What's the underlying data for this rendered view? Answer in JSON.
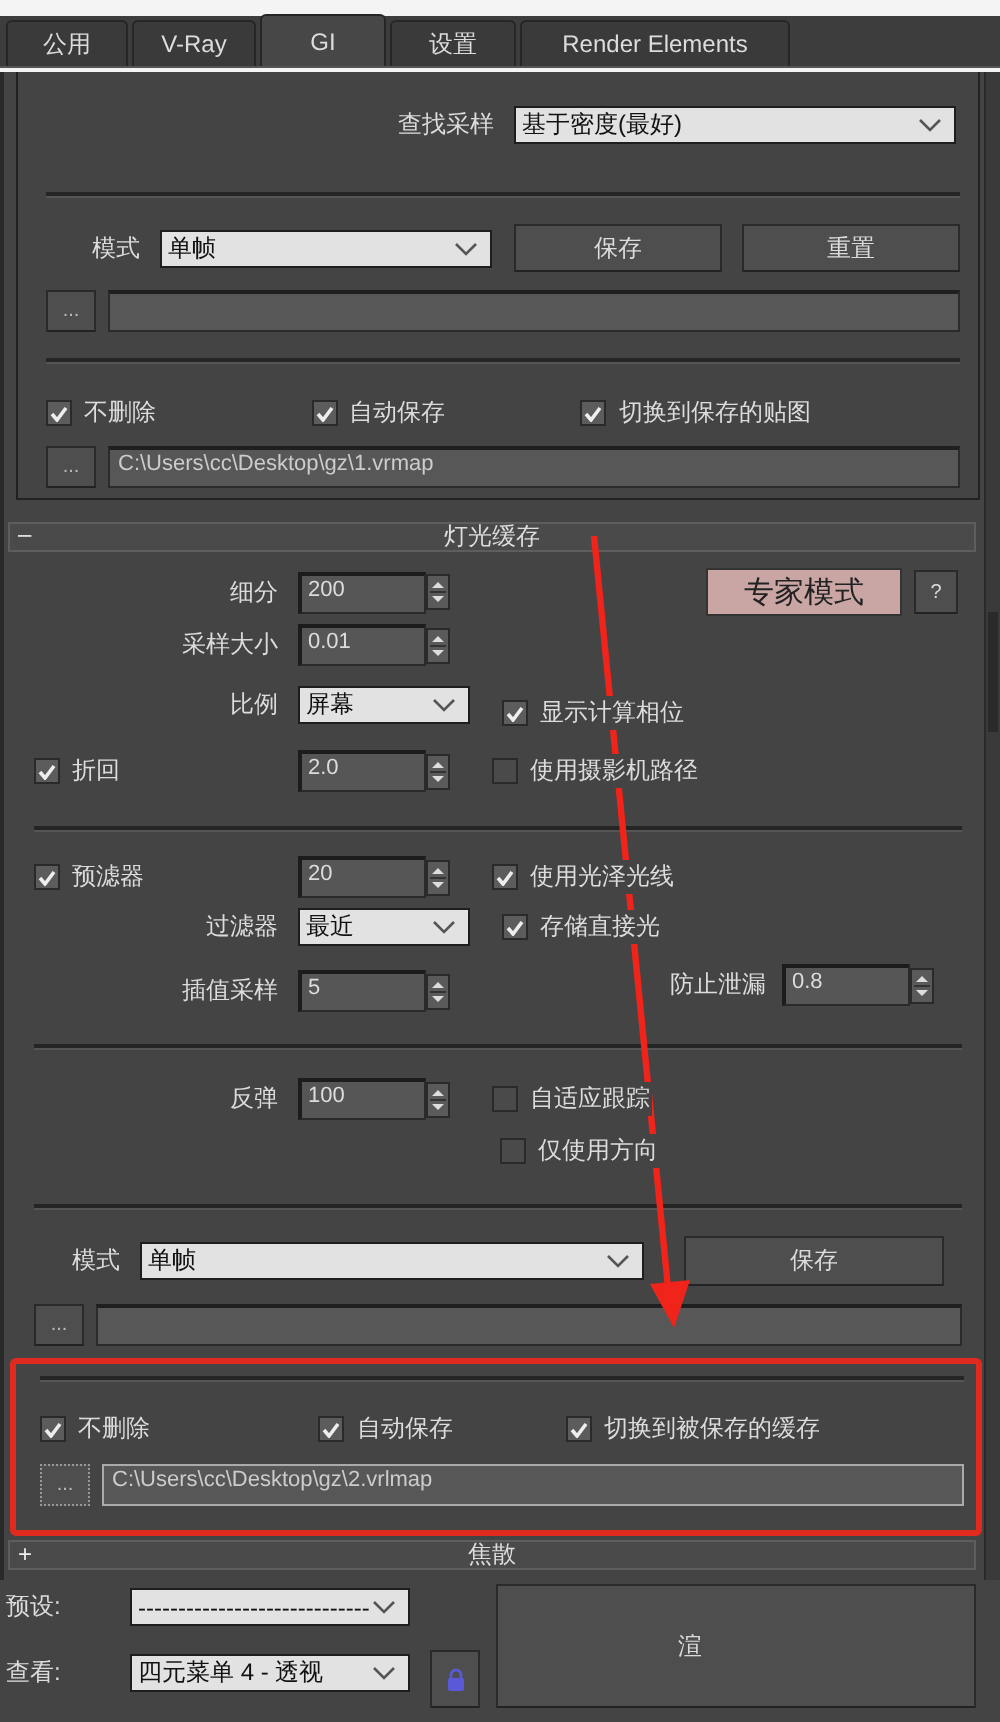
{
  "tabs": [
    {
      "label": "公用",
      "selected": false
    },
    {
      "label": "V-Ray",
      "selected": false
    },
    {
      "label": "GI",
      "selected": true
    },
    {
      "label": "设置",
      "selected": false
    },
    {
      "label": "Render Elements",
      "selected": false
    }
  ],
  "irradiance_map": {
    "lookup": {
      "label": "查找采样",
      "value": "基于密度(最好)"
    },
    "mode": {
      "label": "模式",
      "value": "单帧"
    },
    "buttons": [
      "保存",
      "重置"
    ],
    "file_browse": "...",
    "options": [
      {
        "label": "不删除",
        "checked": true
      },
      {
        "label": "自动保存",
        "checked": true
      },
      {
        "label": "切换到保存的贴图",
        "checked": true
      }
    ],
    "auto_save_browse": "...",
    "auto_save_path": "C:\\Users\\cc\\Desktop\\gz\\1.vrmap"
  },
  "light_cache": {
    "title": "灯光缓存",
    "toggle": "–",
    "expert_mode": "专家模式",
    "help": "?",
    "subdivs": {
      "label": "细分",
      "value": "200"
    },
    "sample_size": {
      "label": "采样大小",
      "value": "0.01"
    },
    "scale": {
      "label": "比例",
      "value": "屏幕"
    },
    "show_calc_phase": {
      "label": "显示计算相位",
      "checked": true
    },
    "retrace": {
      "label": "折回",
      "checked": true,
      "value": "2.0"
    },
    "use_camera_path": {
      "label": "使用摄影机路径",
      "checked": false
    },
    "prefilter": {
      "label": "预滤器",
      "checked": true,
      "value": "20"
    },
    "use_glossy_rays": {
      "label": "使用光泽光线",
      "checked": true
    },
    "filter": {
      "label": "过滤器",
      "value": "最近"
    },
    "store_direct_light": {
      "label": "存储直接光",
      "checked": true
    },
    "interp_samples": {
      "label": "插值采样",
      "value": "5"
    },
    "leak_prevention": {
      "label": "防止泄漏",
      "value": "0.8"
    },
    "bounces": {
      "label": "反弹",
      "value": "100"
    },
    "adaptive_tracing": {
      "label": "自适应跟踪",
      "checked": false
    },
    "use_directions_only": {
      "label": "仅使用方向",
      "checked": false
    },
    "mode": {
      "label": "模式",
      "value": "单帧"
    },
    "save_button": "保存",
    "file_browse": "...",
    "highlighted": true,
    "options": [
      {
        "label": "不删除",
        "checked": true
      },
      {
        "label": "自动保存",
        "checked": true
      },
      {
        "label": "切换到被保存的缓存",
        "checked": true
      }
    ],
    "auto_save_browse": "...",
    "auto_save_path": "C:\\Users\\cc\\Desktop\\gz\\2.vrlmap"
  },
  "caustics": {
    "title": "焦散",
    "toggle": "+"
  },
  "footer": {
    "preset": {
      "label": "预设:",
      "value": "-----------------------------"
    },
    "view": {
      "label": "查看:",
      "value": "四元菜单 4 - 透视"
    },
    "render_button": "渲"
  }
}
